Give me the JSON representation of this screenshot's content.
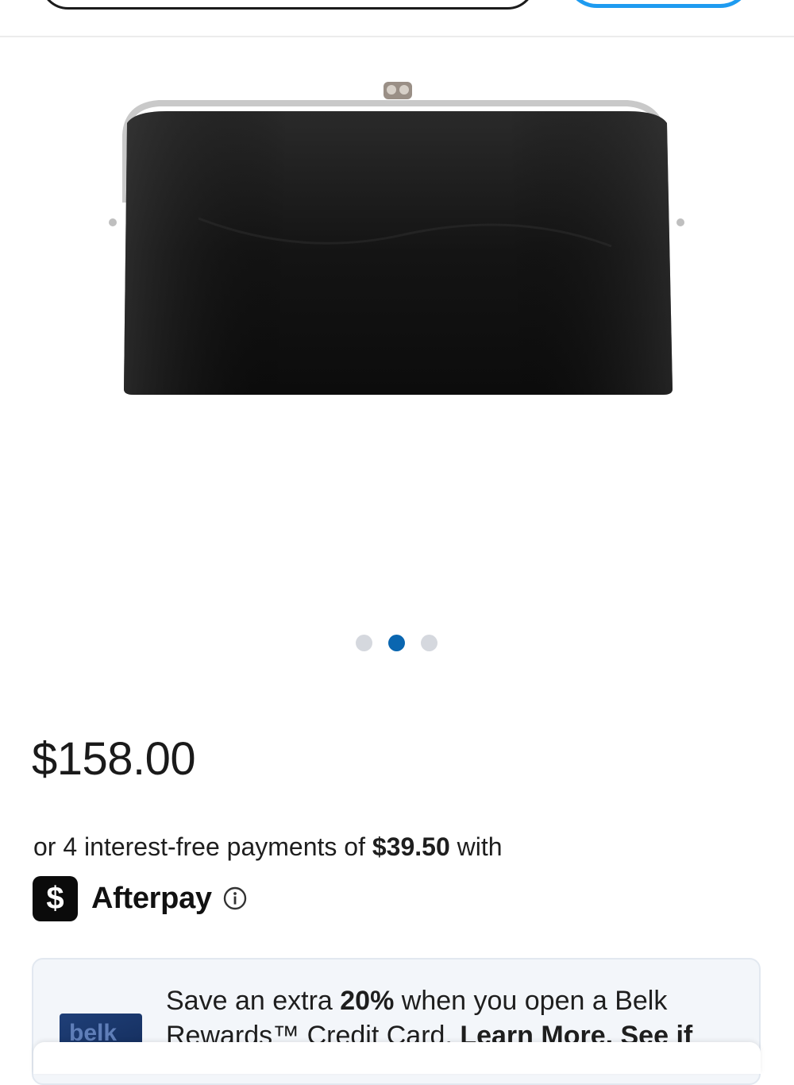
{
  "product": {
    "image_alt": "Black leather clutch wallet with silver frame"
  },
  "carousel": {
    "count": 3,
    "active_index": 1
  },
  "pricing": {
    "price": "$158.00",
    "installment_prefix": "or 4 interest-free payments of ",
    "installment_amount": "$39.50",
    "installment_suffix": " with"
  },
  "afterpay": {
    "logo_glyph": "$",
    "label": "Afterpay"
  },
  "promo": {
    "text_1": "Save an extra ",
    "percent": "20%",
    "text_2": " when you open a Belk Rewards™ Credit Card. ",
    "learn_more": "Learn More",
    "text_3": ". See if",
    "card_logo": "belk"
  },
  "colors": {
    "accent_blue": "#1e9bf0",
    "dot_active": "#0a66b0",
    "dot_inactive": "#d5d8de"
  }
}
